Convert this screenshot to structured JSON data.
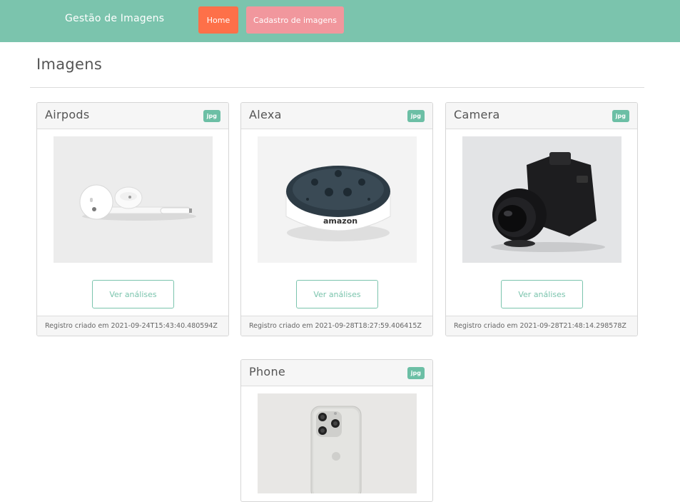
{
  "navbar": {
    "brand": "Gestão de Imagens",
    "home_label": "Home",
    "cadastro_label": "Cadastro de imagens"
  },
  "page": {
    "title": "Imagens"
  },
  "cards": [
    {
      "title": "Airpods",
      "badge": "jpg",
      "button_label": "Ver análises",
      "footer": "Registro criado em 2021-09-24T15:43:40.480594Z"
    },
    {
      "title": "Alexa",
      "badge": "jpg",
      "button_label": "Ver análises",
      "footer": "Registro criado em 2021-09-28T18:27:59.406415Z"
    },
    {
      "title": "Camera",
      "badge": "jpg",
      "button_label": "Ver análises",
      "footer": "Registro criado em 2021-09-28T21:48:14.298578Z"
    },
    {
      "title": "Phone",
      "badge": "jpg"
    }
  ],
  "colors": {
    "navbar": "#7bc4ad",
    "home_button": "#fe7049",
    "cadastro_button": "#f1979d",
    "badge": "#6cbfa5"
  }
}
